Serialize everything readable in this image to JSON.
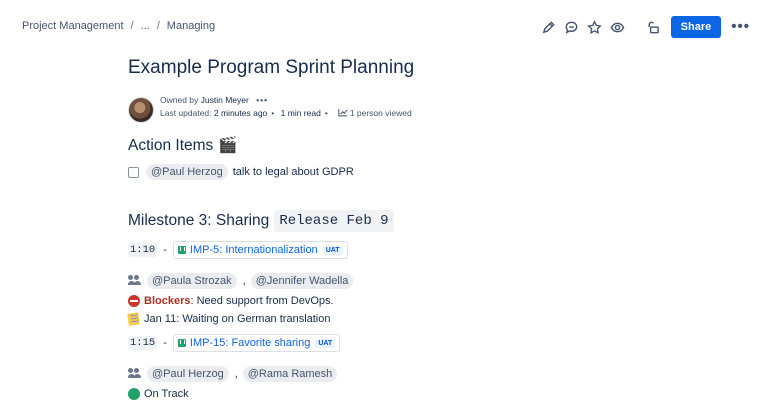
{
  "breadcrumb": {
    "items": [
      "Project Management",
      "...",
      "Managing"
    ],
    "separator": "/"
  },
  "toolbar": {
    "share_label": "Share",
    "more_label": "•••",
    "icons": [
      "pencil-icon",
      "comment-icon",
      "star-icon",
      "eye-icon",
      "restrictions-icon"
    ]
  },
  "page": {
    "title": "Example Program Sprint Planning",
    "byline": {
      "owned_by_label": "Owned by",
      "owner": "Justin Meyer",
      "owner_more": "•••",
      "last_updated_label": "Last updated:",
      "last_updated_value": "2 minutes ago",
      "read_time": "1 min read",
      "views": "1 person viewed"
    }
  },
  "action_items": {
    "heading": "Action Items",
    "heading_emoji": "🎬",
    "tasks": [
      {
        "checked": false,
        "mention": "@Paul Herzog",
        "text": "talk to legal about GDPR"
      }
    ]
  },
  "milestone": {
    "heading": "Milestone 3: Sharing",
    "release_code": "Release Feb 9",
    "items": [
      {
        "time": "1:10",
        "dash": "-",
        "issue": "IMP-5: Internationalization",
        "status": "UAT",
        "people": [
          "@Paula Strozak",
          "@Jennifer Wadella"
        ],
        "blocker_label": "Blockers",
        "blocker_text": ": Need support from DevOps.",
        "note": "Jan 11: Waiting on German translation"
      },
      {
        "time": "1:15",
        "dash": "-",
        "issue": "IMP-15: Favorite sharing",
        "status": "UAT",
        "people": [
          "@Paul Herzog",
          "@Rama Ramesh"
        ],
        "status_text": "On Track"
      }
    ],
    "comma": ","
  },
  "colors": {
    "primary": "#0c66e4",
    "text": "#172b4d",
    "subtle": "#44546f",
    "danger": "#ae2e24",
    "success": "#22a06b"
  }
}
